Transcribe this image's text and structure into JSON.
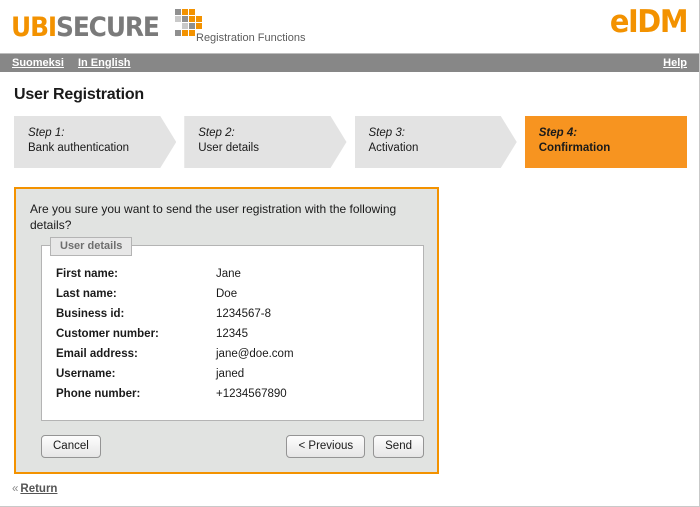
{
  "header": {
    "logo_ubi": "UBI",
    "logo_secure": "SECURE",
    "logo_dots_icon": "pixel-arrow-icon",
    "subtitle": "Registration Functions",
    "product": "eIDM",
    "brand_orange": "#f39200",
    "brand_gray": "#7a7a7a"
  },
  "navbar": {
    "background": "#878787",
    "links": [
      {
        "label": "Suomeksi"
      },
      {
        "label": "In English"
      }
    ],
    "help_label": "Help"
  },
  "main": {
    "page_title": "User Registration",
    "steps": [
      {
        "number": "Step 1:",
        "label": "Bank authentication",
        "active": false
      },
      {
        "number": "Step 2:",
        "label": "User details",
        "active": false
      },
      {
        "number": "Step 3:",
        "label": "Activation",
        "active": false
      },
      {
        "number": "Step 4:",
        "label": "Confirmation",
        "active": true
      }
    ],
    "active_step_color": "#f79420",
    "inactive_step_color": "#e3e3e3"
  },
  "confirm": {
    "question": "Are you sure you want to send the user registration with the following details?",
    "panel_border_color": "#f39200",
    "panel_background": "#e1e3e1",
    "fieldset_legend": "User details",
    "details": [
      {
        "label": "First name:",
        "value": "Jane"
      },
      {
        "label": "Last name:",
        "value": "Doe"
      },
      {
        "label": "Business id:",
        "value": "1234567-8"
      },
      {
        "label": "Customer number:",
        "value": "12345"
      },
      {
        "label": "Email address:",
        "value": "jane@doe.com"
      },
      {
        "label": "Username:",
        "value": "janed"
      },
      {
        "label": "Phone number:",
        "value": "+1234567890"
      }
    ],
    "buttons": {
      "cancel": "Cancel",
      "previous": "< Previous",
      "send": "Send"
    }
  },
  "footer": {
    "return_chevron": "«",
    "return_label": "Return"
  }
}
